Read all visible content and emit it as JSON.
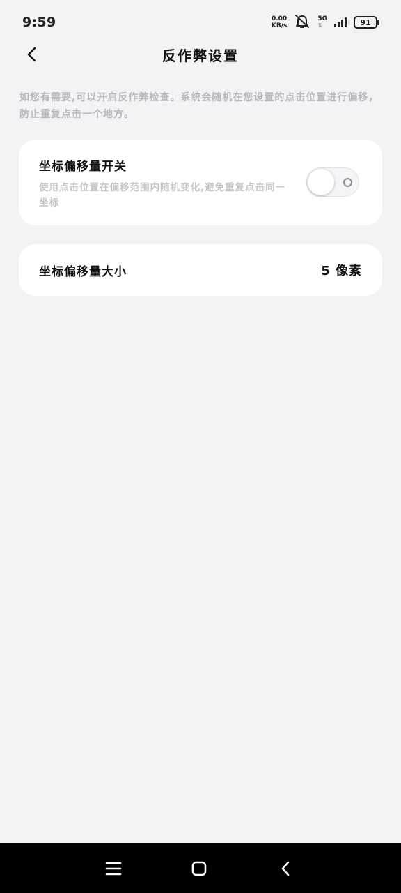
{
  "status_bar": {
    "time": "9:59",
    "net_speed_value": "0.00",
    "net_speed_unit": "KB/s",
    "net_type": "5G",
    "battery": "91",
    "icons": [
      "mute-bell-icon",
      "signal-icon",
      "battery-icon"
    ]
  },
  "header": {
    "title": "反作弊设置",
    "back_icon": "chevron-left-icon"
  },
  "description": "如您有需要,可以开启反作弊检查。系统会随机在您设置的点击位置进行偏移，防止重复点击一个地方。",
  "offset_switch": {
    "title": "坐标偏移量开关",
    "description": "使用点击位置在偏移范围内随机变化,避免重复点击同一坐标",
    "enabled": false
  },
  "offset_size": {
    "label": "坐标偏移量大小",
    "value": "5 像素"
  },
  "nav_bar": {
    "icons": [
      "menu-icon",
      "home-icon",
      "back-icon"
    ]
  },
  "colors": {
    "background": "#f2f3f5",
    "card": "#ffffff",
    "muted_text": "#b6b8bc",
    "nav_bar": "#000000"
  }
}
